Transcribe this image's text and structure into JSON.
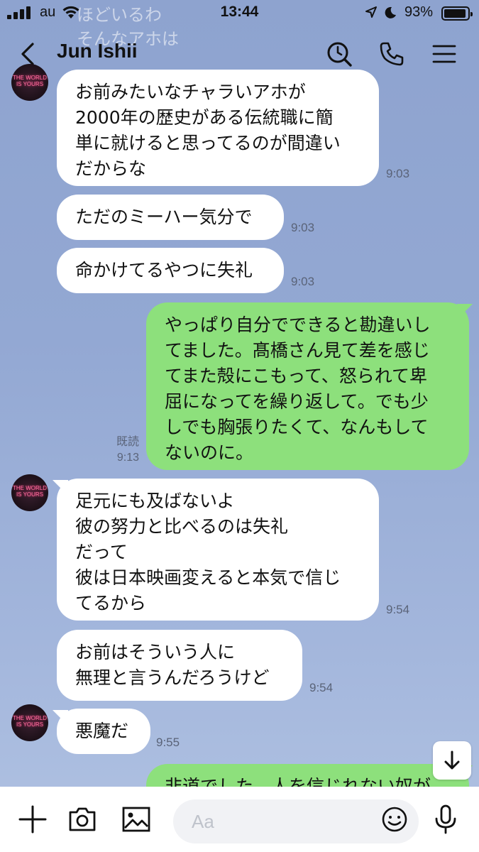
{
  "status_bar": {
    "carrier": "au",
    "time": "13:44",
    "battery": "93%",
    "battery_level": 0.93
  },
  "ghost_preview": {
    "line1": "ほどいるわ",
    "line2": "そんなアホは"
  },
  "header": {
    "title": "Jun Ishii"
  },
  "messages": [
    {
      "side": "in",
      "text": "お前みたいなチャラいアホが\n2000年の歴史がある伝統職に簡\n単に就けると思ってるのが間違い\nだからな",
      "time": "9:03"
    },
    {
      "side": "in",
      "text": "ただのミーハー気分で",
      "time": "9:03"
    },
    {
      "side": "in",
      "text": "命かけてるやつに失礼",
      "time": "9:03"
    },
    {
      "side": "out",
      "text": "やっぱり自分でできると勘違いし\nてました。髙橋さん見て差を感じ\nてまた殻にこもって、怒られて卑\n屈になってを繰り返して。でも少\nしでも胸張りたくて、なんもして\nないのに。",
      "read": "既読",
      "time": "9:13"
    },
    {
      "side": "in",
      "text": "足元にも及ばないよ\n彼の努力と比べるのは失礼\nだって\n彼は日本映画変えると本気で信じ\nてるから",
      "time": "9:54"
    },
    {
      "side": "in",
      "text": "お前はそういう人に\n無理と言うんだろうけど",
      "time": "9:54"
    },
    {
      "side": "in",
      "text": "悪魔だ",
      "time": "9:55"
    },
    {
      "side": "out",
      "text": "非道でした。人を信じれない奴が",
      "time": ""
    }
  ],
  "avatar": {
    "line1": "THE WORLD",
    "line2": "IS YOURS"
  },
  "input": {
    "placeholder": "Aa"
  },
  "colors": {
    "background": "#93a8d3",
    "incoming_bubble": "#ffffff",
    "outgoing_bubble": "#8de07c"
  }
}
